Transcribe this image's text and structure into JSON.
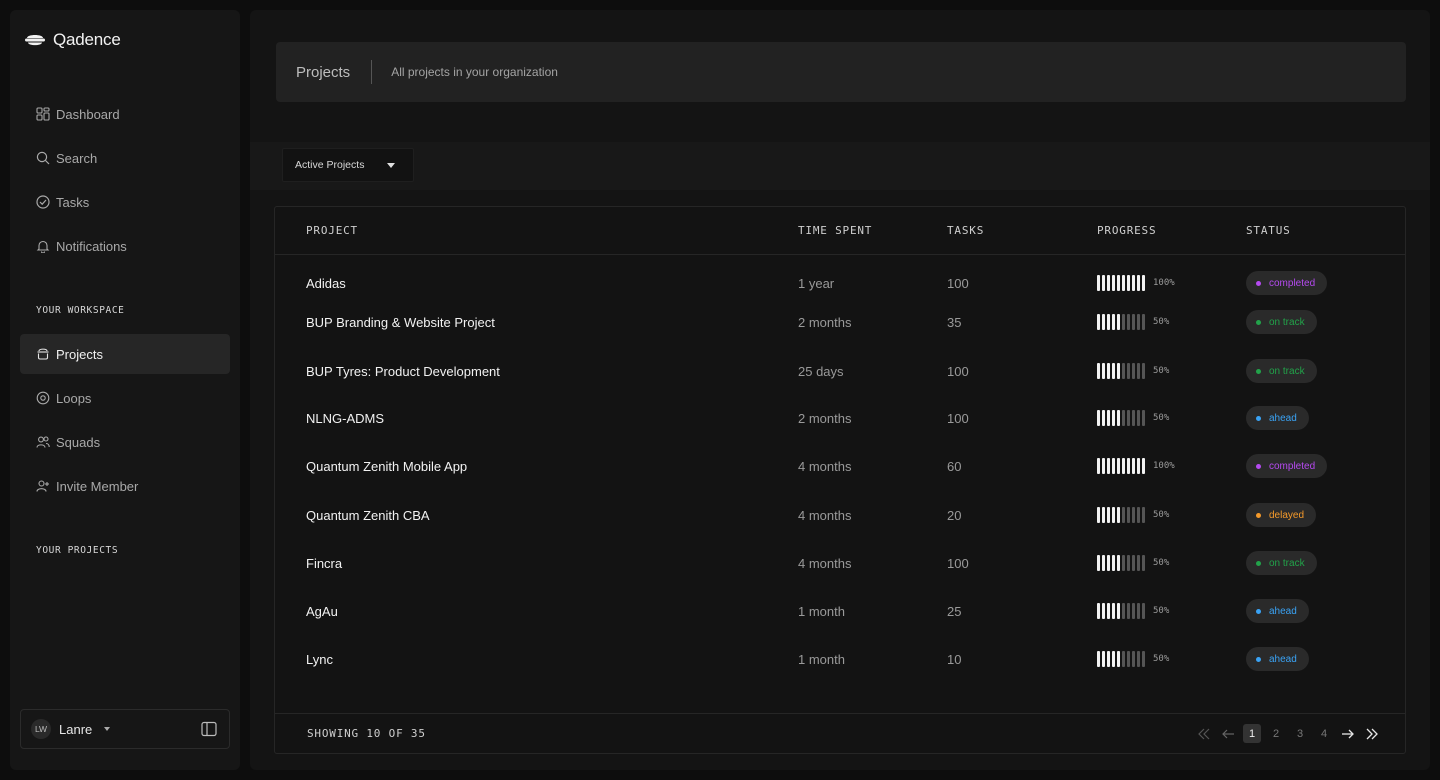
{
  "app": {
    "name": "Qadence"
  },
  "sidebar": {
    "nav": [
      {
        "label": "Dashboard",
        "icon": "dashboard-icon"
      },
      {
        "label": "Search",
        "icon": "search-icon"
      },
      {
        "label": "Tasks",
        "icon": "check-circle-icon"
      },
      {
        "label": "Notifications",
        "icon": "bell-icon"
      }
    ],
    "workspace_label": "YOUR WORKSPACE",
    "workspace": [
      {
        "label": "Projects",
        "icon": "pot-icon",
        "active": true
      },
      {
        "label": "Loops",
        "icon": "loop-icon"
      },
      {
        "label": "Squads",
        "icon": "users-icon"
      },
      {
        "label": "Invite Member",
        "icon": "user-plus-icon"
      }
    ],
    "projects_label": "YOUR PROJECTS",
    "user": {
      "initials": "LW",
      "name": "Lanre"
    }
  },
  "header": {
    "title": "Projects",
    "subtitle": "All projects in your organization"
  },
  "filter": {
    "selected": "Active Projects"
  },
  "table": {
    "columns": {
      "project": "PROJECT",
      "time": "TIME SPENT",
      "tasks": "TASKS",
      "progress": "PROGRESS",
      "status": "STATUS"
    },
    "rows": [
      {
        "name": "Adidas",
        "time": "1 year",
        "tasks": "100",
        "progress": "100%",
        "progress_value": 1.0,
        "status": "completed"
      },
      {
        "name": "BUP Branding & Website Project",
        "time": "2 months",
        "tasks": "35",
        "progress": "50%",
        "progress_value": 0.5,
        "status": "on track"
      },
      {
        "name": "BUP Tyres: Product Development",
        "time": "25 days",
        "tasks": "100",
        "progress": "50%",
        "progress_value": 0.5,
        "status": "on track"
      },
      {
        "name": "NLNG-ADMS",
        "time": "2 months",
        "tasks": "100",
        "progress": "50%",
        "progress_value": 0.5,
        "status": "ahead"
      },
      {
        "name": "Quantum Zenith Mobile App",
        "time": "4 months",
        "tasks": "60",
        "progress": "100%",
        "progress_value": 1.0,
        "status": "completed"
      },
      {
        "name": "Quantum Zenith CBA",
        "time": "4 months",
        "tasks": "20",
        "progress": "50%",
        "progress_value": 0.5,
        "status": "delayed"
      },
      {
        "name": "Fincra",
        "time": "4 months",
        "tasks": "100",
        "progress": "50%",
        "progress_value": 0.5,
        "status": "on track"
      },
      {
        "name": "AgAu",
        "time": "1 month",
        "tasks": "25",
        "progress": "50%",
        "progress_value": 0.5,
        "status": "ahead"
      },
      {
        "name": "Lync",
        "time": "1 month",
        "tasks": "10",
        "progress": "50%",
        "progress_value": 0.5,
        "status": "ahead"
      }
    ]
  },
  "status_colors": {
    "completed": "#b54af0",
    "on track": "#22a34a",
    "ahead": "#3aa3f5",
    "delayed": "#f59a2a"
  },
  "footer": {
    "showing": "SHOWING 10 OF 35",
    "pages": [
      "1",
      "2",
      "3",
      "4"
    ],
    "current_page": "1"
  }
}
